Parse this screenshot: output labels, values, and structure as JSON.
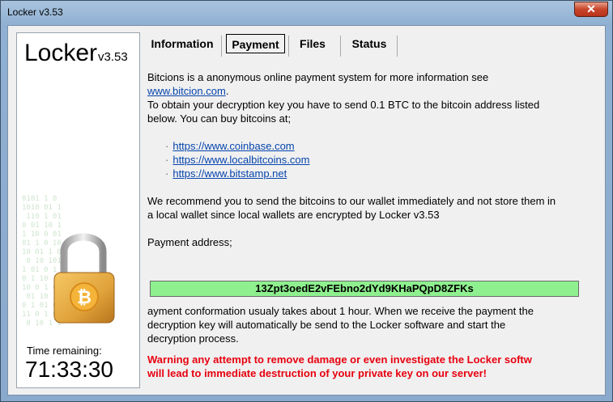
{
  "window": {
    "title": "Locker v3.53",
    "close_label": "✕"
  },
  "brand": {
    "name": "Locker",
    "version": "v3.53"
  },
  "timer": {
    "label": "Time remaining:",
    "value": "71:33:30"
  },
  "tabs": [
    {
      "label": "Information",
      "active": false
    },
    {
      "label": "Payment",
      "active": true
    },
    {
      "label": "Files",
      "active": false
    },
    {
      "label": "Status",
      "active": false
    }
  ],
  "payment": {
    "intro_line1": "Bitcions is a anonymous online payment system for more information see",
    "intro_link": "www.bitcion.com",
    "intro_link_suffix": ".",
    "obtain_line1": "To obtain your decryption key you have to send 0.1 BTC to the bitcoin address listed",
    "obtain_line2": "below. You can buy bitcoins at;",
    "links": [
      "https://www.coinbase.com",
      "https://www.localbitcoins.com",
      "https://www.bitstamp.net"
    ],
    "recommend_line1": "We recommend you to send the bitcoins to our wallet immediately and not store them in",
    "recommend_line2": "a local wallet since local wallets are encrypted by Locker v3.53",
    "address_label": "Payment address;",
    "address": "13Zpt3oedE2vFEbno2dYd9KHaPQpD8ZFKs",
    "confirm_line1": "ayment conformation usualy takes about 1 hour. When we receive the payment the",
    "confirm_line2": "decryption key will automatically be send to the Locker software and start the",
    "confirm_line3": "decryption process.",
    "warning_line1": "Warning any attempt to remove damage or even investigate the Locker softw",
    "warning_line2": "will lead to immediate destruction of your private key on our server!"
  },
  "colors": {
    "address_bg": "#8ef08e",
    "warning": "#e8000f",
    "link": "#0645ad",
    "padlock_gold": "#e0a23a"
  }
}
